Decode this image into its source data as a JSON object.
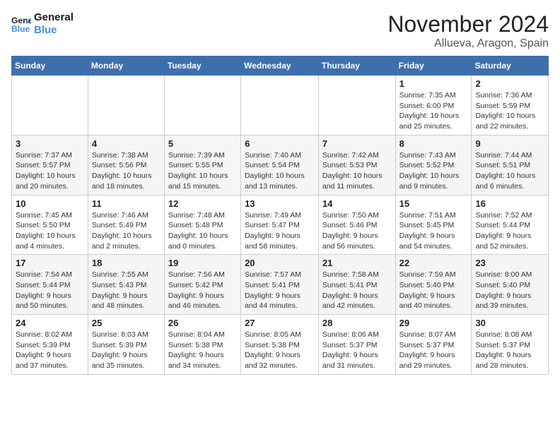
{
  "header": {
    "logo_line1": "General",
    "logo_line2": "Blue",
    "month": "November 2024",
    "location": "Allueva, Aragon, Spain"
  },
  "days_of_week": [
    "Sunday",
    "Monday",
    "Tuesday",
    "Wednesday",
    "Thursday",
    "Friday",
    "Saturday"
  ],
  "weeks": [
    [
      {
        "day": "",
        "info": ""
      },
      {
        "day": "",
        "info": ""
      },
      {
        "day": "",
        "info": ""
      },
      {
        "day": "",
        "info": ""
      },
      {
        "day": "",
        "info": ""
      },
      {
        "day": "1",
        "info": "Sunrise: 7:35 AM\nSunset: 6:00 PM\nDaylight: 10 hours and 25 minutes."
      },
      {
        "day": "2",
        "info": "Sunrise: 7:36 AM\nSunset: 5:59 PM\nDaylight: 10 hours and 22 minutes."
      }
    ],
    [
      {
        "day": "3",
        "info": "Sunrise: 7:37 AM\nSunset: 5:57 PM\nDaylight: 10 hours and 20 minutes."
      },
      {
        "day": "4",
        "info": "Sunrise: 7:38 AM\nSunset: 5:56 PM\nDaylight: 10 hours and 18 minutes."
      },
      {
        "day": "5",
        "info": "Sunrise: 7:39 AM\nSunset: 5:55 PM\nDaylight: 10 hours and 15 minutes."
      },
      {
        "day": "6",
        "info": "Sunrise: 7:40 AM\nSunset: 5:54 PM\nDaylight: 10 hours and 13 minutes."
      },
      {
        "day": "7",
        "info": "Sunrise: 7:42 AM\nSunset: 5:53 PM\nDaylight: 10 hours and 11 minutes."
      },
      {
        "day": "8",
        "info": "Sunrise: 7:43 AM\nSunset: 5:52 PM\nDaylight: 10 hours and 9 minutes."
      },
      {
        "day": "9",
        "info": "Sunrise: 7:44 AM\nSunset: 5:51 PM\nDaylight: 10 hours and 6 minutes."
      }
    ],
    [
      {
        "day": "10",
        "info": "Sunrise: 7:45 AM\nSunset: 5:50 PM\nDaylight: 10 hours and 4 minutes."
      },
      {
        "day": "11",
        "info": "Sunrise: 7:46 AM\nSunset: 5:49 PM\nDaylight: 10 hours and 2 minutes."
      },
      {
        "day": "12",
        "info": "Sunrise: 7:48 AM\nSunset: 5:48 PM\nDaylight: 10 hours and 0 minutes."
      },
      {
        "day": "13",
        "info": "Sunrise: 7:49 AM\nSunset: 5:47 PM\nDaylight: 9 hours and 58 minutes."
      },
      {
        "day": "14",
        "info": "Sunrise: 7:50 AM\nSunset: 5:46 PM\nDaylight: 9 hours and 56 minutes."
      },
      {
        "day": "15",
        "info": "Sunrise: 7:51 AM\nSunset: 5:45 PM\nDaylight: 9 hours and 54 minutes."
      },
      {
        "day": "16",
        "info": "Sunrise: 7:52 AM\nSunset: 5:44 PM\nDaylight: 9 hours and 52 minutes."
      }
    ],
    [
      {
        "day": "17",
        "info": "Sunrise: 7:54 AM\nSunset: 5:44 PM\nDaylight: 9 hours and 50 minutes."
      },
      {
        "day": "18",
        "info": "Sunrise: 7:55 AM\nSunset: 5:43 PM\nDaylight: 9 hours and 48 minutes."
      },
      {
        "day": "19",
        "info": "Sunrise: 7:56 AM\nSunset: 5:42 PM\nDaylight: 9 hours and 46 minutes."
      },
      {
        "day": "20",
        "info": "Sunrise: 7:57 AM\nSunset: 5:41 PM\nDaylight: 9 hours and 44 minutes."
      },
      {
        "day": "21",
        "info": "Sunrise: 7:58 AM\nSunset: 5:41 PM\nDaylight: 9 hours and 42 minutes."
      },
      {
        "day": "22",
        "info": "Sunrise: 7:59 AM\nSunset: 5:40 PM\nDaylight: 9 hours and 40 minutes."
      },
      {
        "day": "23",
        "info": "Sunrise: 8:00 AM\nSunset: 5:40 PM\nDaylight: 9 hours and 39 minutes."
      }
    ],
    [
      {
        "day": "24",
        "info": "Sunrise: 8:02 AM\nSunset: 5:39 PM\nDaylight: 9 hours and 37 minutes."
      },
      {
        "day": "25",
        "info": "Sunrise: 8:03 AM\nSunset: 5:39 PM\nDaylight: 9 hours and 35 minutes."
      },
      {
        "day": "26",
        "info": "Sunrise: 8:04 AM\nSunset: 5:38 PM\nDaylight: 9 hours and 34 minutes."
      },
      {
        "day": "27",
        "info": "Sunrise: 8:05 AM\nSunset: 5:38 PM\nDaylight: 9 hours and 32 minutes."
      },
      {
        "day": "28",
        "info": "Sunrise: 8:06 AM\nSunset: 5:37 PM\nDaylight: 9 hours and 31 minutes."
      },
      {
        "day": "29",
        "info": "Sunrise: 8:07 AM\nSunset: 5:37 PM\nDaylight: 9 hours and 29 minutes."
      },
      {
        "day": "30",
        "info": "Sunrise: 8:08 AM\nSunset: 5:37 PM\nDaylight: 9 hours and 28 minutes."
      }
    ]
  ]
}
